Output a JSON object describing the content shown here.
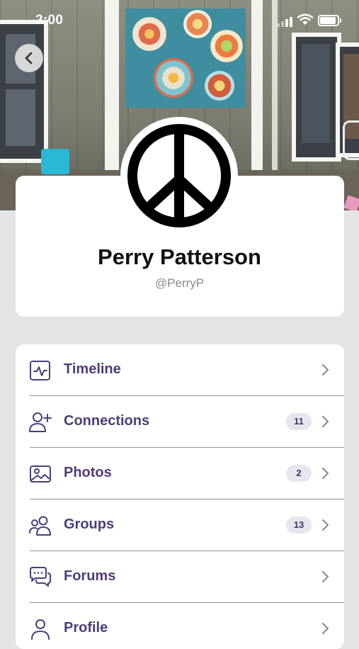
{
  "status_bar": {
    "time": "2:00"
  },
  "profile": {
    "name": "Perry Patterson",
    "handle": "@PerryP"
  },
  "menu": [
    {
      "label": "Timeline",
      "icon": "activity-icon",
      "badge": null
    },
    {
      "label": "Connections",
      "icon": "add-user-icon",
      "badge": "11"
    },
    {
      "label": "Photos",
      "icon": "image-icon",
      "badge": "2"
    },
    {
      "label": "Groups",
      "icon": "group-icon",
      "badge": "13"
    },
    {
      "label": "Forums",
      "icon": "chat-bubbles-icon",
      "badge": null
    },
    {
      "label": "Profile",
      "icon": "user-icon",
      "badge": null
    }
  ],
  "colors": {
    "accent": "#4d3d7a",
    "background": "#e4e4e6",
    "card": "#ffffff",
    "badge_bg": "#e6e6ee"
  }
}
